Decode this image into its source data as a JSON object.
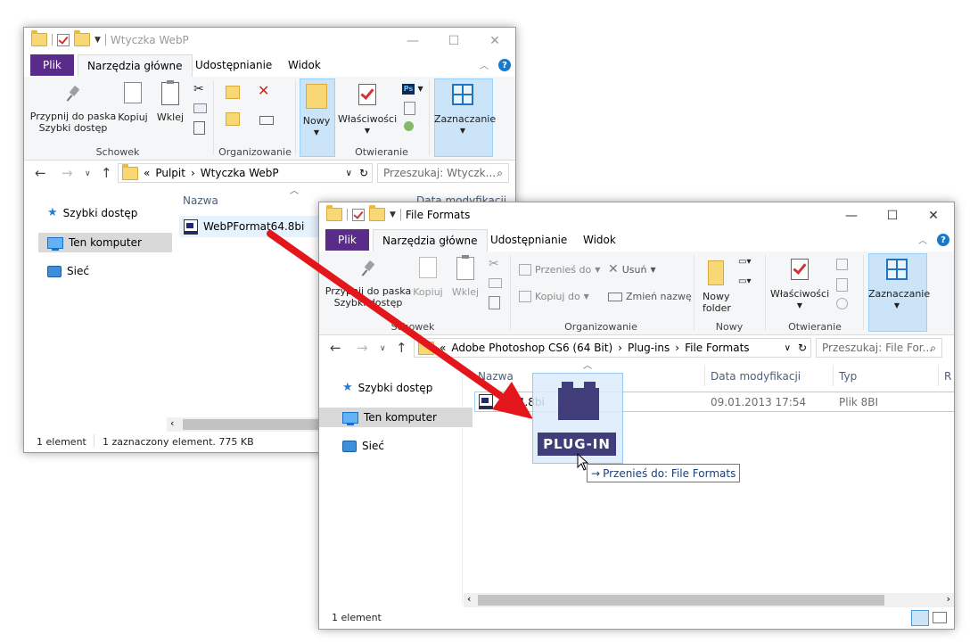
{
  "back_window": {
    "title": "Wtyczka WebP",
    "tabs": {
      "file": "Plik",
      "home": "Narzędzia główne",
      "share": "Udostępnianie",
      "view": "Widok"
    },
    "ribbon": {
      "pin": "Przypnij do paska Szybki dostęp",
      "copy": "Kopiuj",
      "paste": "Wklej",
      "new": "Nowy",
      "properties": "Właściwości",
      "select": "Zaznaczanie",
      "groups": {
        "clipboard": "Schowek",
        "organize": "Organizowanie",
        "open": "Otwieranie"
      }
    },
    "address": {
      "prefix": "«",
      "crumbs": [
        "Pulpit",
        "Wtyczka WebP"
      ]
    },
    "search_placeholder": "Przeszukaj: Wtyczk...",
    "nav": {
      "quick": "Szybki dostęp",
      "pc": "Ten komputer",
      "network": "Sieć"
    },
    "columns": {
      "name": "Nazwa",
      "date": "Data modyfikacji"
    },
    "files": [
      {
        "name": "WebPFormat64.8bi"
      }
    ],
    "status": {
      "count": "1 element",
      "selected": "1 zaznaczony element. 775 KB"
    }
  },
  "front_window": {
    "title": "File Formats",
    "tabs": {
      "file": "Plik",
      "home": "Narzędzia główne",
      "share": "Udostępnianie",
      "view": "Widok"
    },
    "ribbon": {
      "pin": "Przypnij do paska Szybki dostęp",
      "copy": "Kopiuj",
      "paste": "Wklej",
      "move_to": "Przenieś do",
      "copy_to": "Kopiuj do",
      "delete": "Usuń",
      "rename": "Zmień nazwę",
      "new_folder": "Nowy folder",
      "properties": "Właściwości",
      "select": "Zaznaczanie",
      "groups": {
        "clipboard": "Schowek",
        "organize": "Organizowanie",
        "new": "Nowy",
        "open": "Otwieranie"
      }
    },
    "address": {
      "prefix": "«",
      "crumbs": [
        "Adobe Photoshop CS6 (64 Bit)",
        "Plug-ins",
        "File Formats"
      ]
    },
    "search_placeholder": "Przeszukaj: File For...",
    "nav": {
      "quick": "Szybki dostęp",
      "pc": "Ten komputer",
      "network": "Sieć"
    },
    "columns": {
      "name": "Nazwa",
      "date": "Data modyfikacji",
      "type": "Typ",
      "extra": "R"
    },
    "files": [
      {
        "name": "...t64.8bi",
        "date": "09.01.2013 17:54",
        "type": "Plik 8BI"
      }
    ],
    "status": {
      "count": "1 element"
    }
  },
  "drag": {
    "icon_label": "PLUG-IN",
    "tooltip": "Przenieś do: File Formats",
    "tooltip_arrow": "→"
  },
  "colors": {
    "accent": "#5a2c8a",
    "arrow": "#e3161b",
    "plugin_bg": "#413d7a"
  }
}
